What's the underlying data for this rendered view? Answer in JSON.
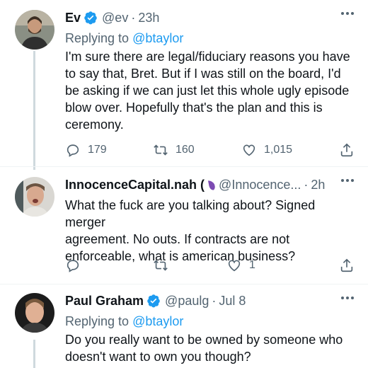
{
  "tweets": [
    {
      "name": "Ev",
      "verified": true,
      "handle": "@ev",
      "separator": "·",
      "time": "23h",
      "replying_prefix": "Replying to",
      "replying_to": "@btaylor",
      "text": "I'm sure there are legal/fiduciary reasons you have\nto say that, Bret. But if I was still on the board, I'd\nbe asking if we can just let this whole ugly episode\nblow over. Hopefully that's the plan and this is\nceremony.",
      "replies": "179",
      "retweets": "160",
      "likes": "1,015"
    },
    {
      "name": "InnocenceCapital.nah (",
      "verified": false,
      "handle": "@Innocence...",
      "separator": "·",
      "time": "2h",
      "text": "What the fuck are you talking about? Signed merger\nagreement. No outs. If contracts are not\nenforceable, what is american business?",
      "replies": "",
      "retweets": "",
      "likes": "1"
    },
    {
      "name": "Paul Graham",
      "verified": true,
      "handle": "@paulg",
      "separator": "·",
      "time": "Jul 8",
      "replying_prefix": "Replying to",
      "replying_to": "@btaylor",
      "text": "Do you really want to be owned by someone who\ndoesn't want to own you though?"
    }
  ],
  "colors": {
    "accent": "#1d9bf0",
    "secondary_text": "#536471",
    "primary_text": "#0f1419",
    "divider": "#eff3f4",
    "thread_line": "#cfd9de"
  },
  "icons": {
    "verified": "verified-badge-icon",
    "more": "more-horizontal-icon",
    "reply": "reply-icon",
    "retweet": "retweet-icon",
    "like": "heart-icon",
    "share": "share-icon",
    "emoji": "purple-eggplant-emoji"
  }
}
